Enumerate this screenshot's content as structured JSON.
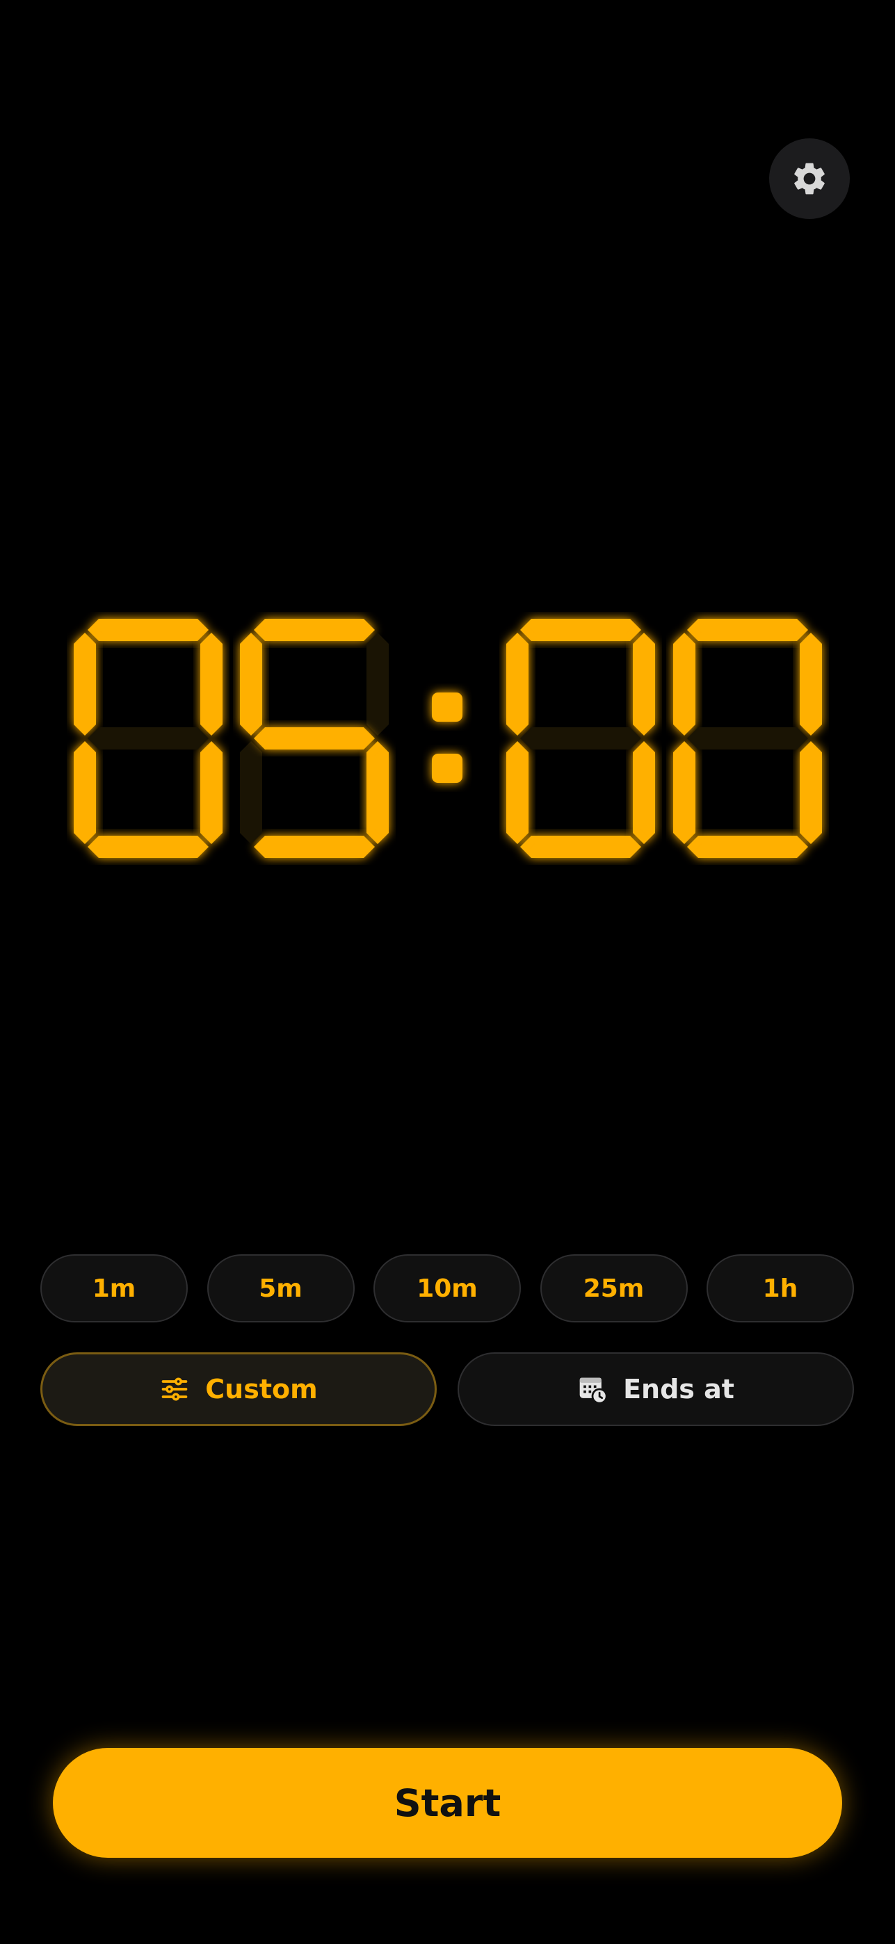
{
  "header": {
    "settings_icon": "gear-icon"
  },
  "timer": {
    "minutes": "05",
    "seconds": "00",
    "digits": [
      "0",
      "5",
      "0",
      "0"
    ],
    "separator": ":",
    "accent_color": "#ffb000"
  },
  "presets": [
    {
      "label": "1m"
    },
    {
      "label": "5m"
    },
    {
      "label": "10m"
    },
    {
      "label": "25m"
    },
    {
      "label": "1h"
    }
  ],
  "options": {
    "custom_label": "Custom",
    "custom_icon": "sliders-icon",
    "ends_at_label": "Ends at",
    "ends_at_icon": "calendar-clock-icon"
  },
  "actions": {
    "start_label": "Start"
  }
}
